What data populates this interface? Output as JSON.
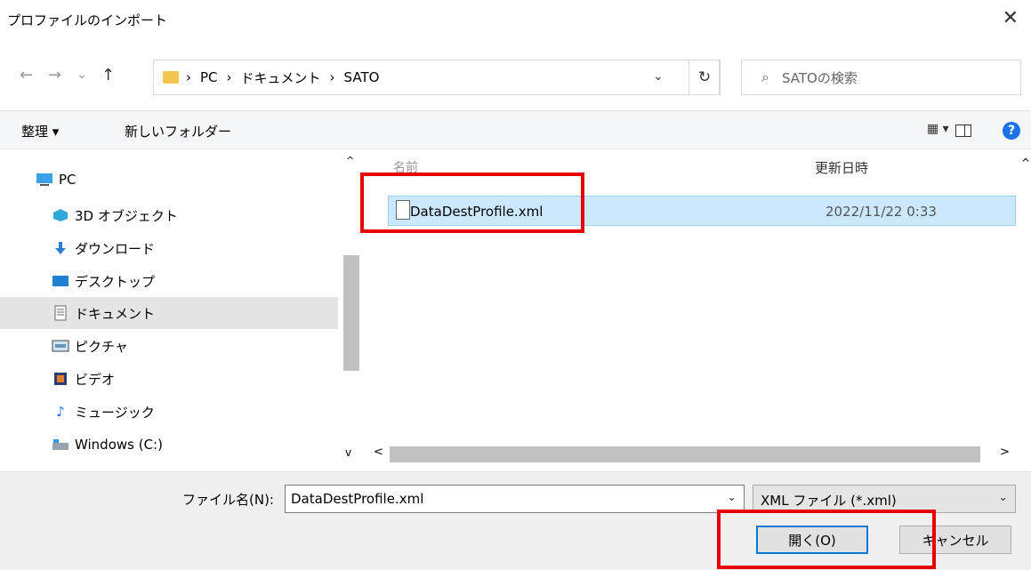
{
  "window": {
    "title": "プロファイルのインポート",
    "close_symbol": "✕"
  },
  "nav_controls": {
    "back": "←",
    "forward": "→",
    "recent": "⌄",
    "up": "↑"
  },
  "address": {
    "crumbs": [
      "PC",
      "ドキュメント",
      "SATO"
    ],
    "separator": "›",
    "dropdown": "⌄"
  },
  "refresh_symbol": "↻",
  "search": {
    "placeholder": "SATOの検索",
    "icon": "⌕"
  },
  "toolbar": {
    "organize": "整理 ▾",
    "new_folder": "新しいフォルダー",
    "view_icon": "▦ ▾",
    "help": "?"
  },
  "sidebar": {
    "items": [
      {
        "label": "PC",
        "icon": "pc-icon"
      },
      {
        "label": "3D オブジェクト",
        "icon": "cube-icon"
      },
      {
        "label": "ダウンロード",
        "icon": "download-icon"
      },
      {
        "label": "デスクトップ",
        "icon": "desktop-icon"
      },
      {
        "label": "ドキュメント",
        "icon": "document-icon",
        "selected": true
      },
      {
        "label": "ピクチャ",
        "icon": "picture-icon"
      },
      {
        "label": "ビデオ",
        "icon": "video-icon"
      },
      {
        "label": "ミュージック",
        "icon": "music-icon"
      },
      {
        "label": "Windows (C:)",
        "icon": "drive-icon"
      }
    ]
  },
  "file_list": {
    "columns": [
      "名前",
      "更新日時"
    ],
    "rows": [
      {
        "name": "DataDestProfile.xml",
        "modified": "2022/11/22 0:33",
        "selected": true
      }
    ]
  },
  "footer": {
    "file_name_label": "ファイル名(N):",
    "file_name_value": "DataDestProfile.xml",
    "filter": "XML ファイル (*.xml)",
    "open_button": "開く(O)",
    "cancel_button": "キャンセル"
  },
  "colors": {
    "highlight": "#e60000",
    "selection": "#cce8ff",
    "accent": "#0078d7"
  }
}
